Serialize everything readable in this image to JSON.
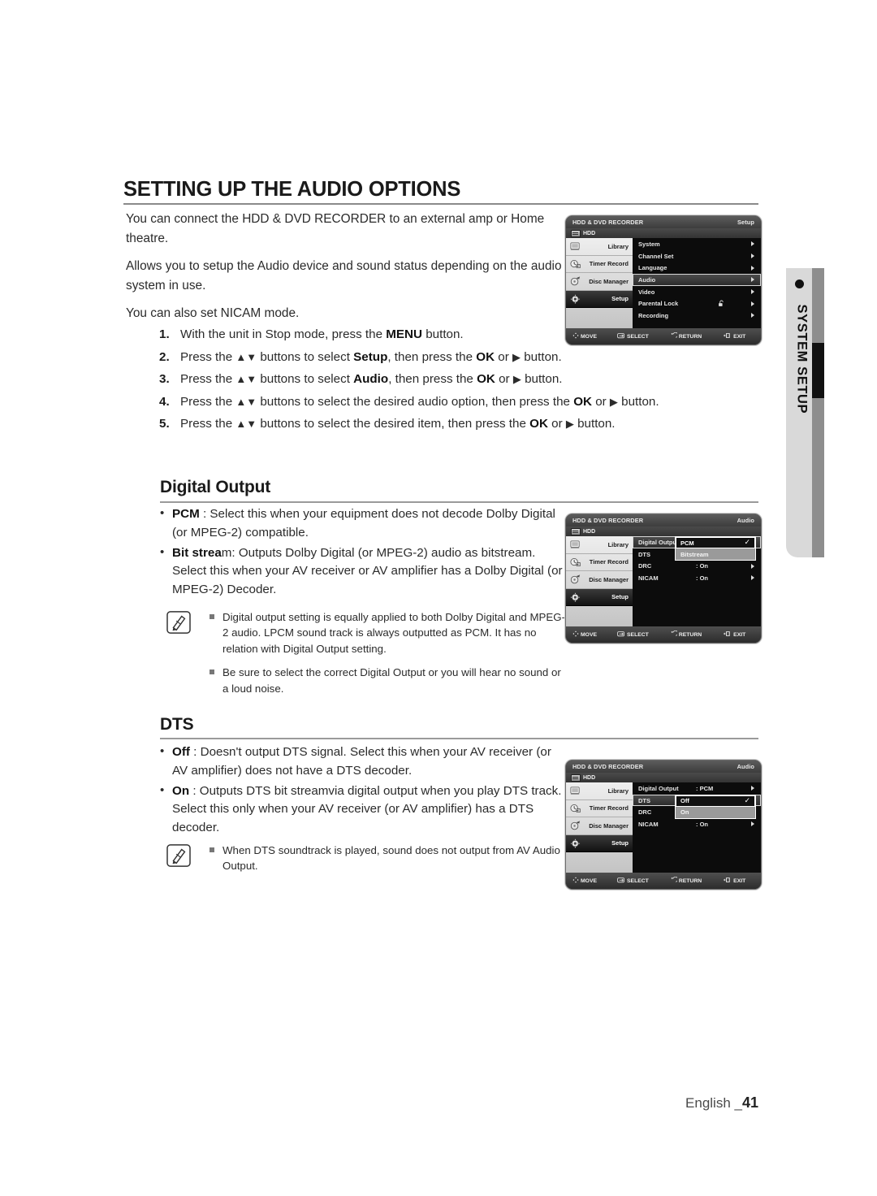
{
  "page": {
    "title": "SETTING UP THE AUDIO OPTIONS",
    "footer_label": "English _",
    "footer_number": "41",
    "side_tab_label": "SYSTEM SETUP"
  },
  "intro": {
    "p1": "You can connect the HDD & DVD RECORDER to an external amp or Home theatre.",
    "p2": "Allows you to setup the Audio device and sound status depending on the audio system in use.",
    "p3": "You can also set NICAM mode."
  },
  "steps": [
    {
      "num": "1.",
      "html": "With the unit in Stop mode, press the <b>MENU</b> button."
    },
    {
      "num": "2.",
      "html": "Press the <span class=\"arrows\">▲▼</span> buttons to select <b>Setup</b>, then press the <b>OK</b> or <span class=\"arrows\">▶</span> button."
    },
    {
      "num": "3.",
      "html": "Press the <span class=\"arrows\">▲▼</span> buttons to select <b>Audio</b>, then press the <b>OK</b> or <span class=\"arrows\">▶</span> button."
    },
    {
      "num": "4.",
      "html": "Press the <span class=\"arrows\">▲▼</span> buttons to select the desired audio option, then press the <b>OK</b> or <span class=\"arrows\">▶</span> button."
    },
    {
      "num": "5.",
      "html": "Press the <span class=\"arrows\">▲▼</span> buttons to select the desired item, then press the <b>OK</b> or <span class=\"arrows\">▶</span> button."
    }
  ],
  "digital_output": {
    "heading": "Digital Output",
    "bullets": [
      "<b>PCM</b> : Select this when your equipment does not decode Dolby Digital (or MPEG-2) compatible.",
      "<b>Bit strea</b>m: Outputs Dolby Digital (or MPEG-2) audio as bitstream. Select this when your AV receiver or AV amplifier has a Dolby Digital (or MPEG-2) Decoder."
    ],
    "notes": [
      "Digital output setting is equally applied to both Dolby Digital and MPEG-2 audio. LPCM sound track is always outputted as PCM. It has no relation with Digital Output setting.",
      "Be sure to select the correct Digital Output or you will hear no sound or a loud noise."
    ]
  },
  "dts": {
    "heading": "DTS",
    "bullets": [
      "<b>Off</b> : Doesn't output DTS signal. Select this when your AV receiver (or AV amplifier) does not have a DTS decoder.",
      "<b>On</b> : Outputs DTS bit streamvia digital output when you play DTS track. Select this only when your AV receiver (or AV amplifier) has a DTS decoder."
    ],
    "notes": [
      "When DTS soundtrack is played, sound does not output from AV Audio Output."
    ]
  },
  "osd_common": {
    "device_title": "HDD & DVD RECORDER",
    "source_label": "HDD",
    "sidebar": [
      {
        "label": "Library",
        "icon": "library-icon",
        "selected": false
      },
      {
        "label": "Timer Record",
        "icon": "timer-record-icon",
        "selected": false
      },
      {
        "label": "Disc Manager",
        "icon": "disc-manager-icon",
        "selected": false
      },
      {
        "label": "Setup",
        "icon": "setup-gear-icon",
        "selected": true
      }
    ],
    "bottom_bar": [
      {
        "icon": "move-icon",
        "label": "MOVE"
      },
      {
        "icon": "select-icon",
        "label": "SELECT"
      },
      {
        "icon": "return-icon",
        "label": "RETURN"
      },
      {
        "icon": "exit-icon",
        "label": "EXIT"
      }
    ]
  },
  "osd1": {
    "context": "Setup",
    "rows": [
      {
        "label": "System",
        "value": "",
        "highlighted": false
      },
      {
        "label": "Channel Set",
        "value": "",
        "highlighted": false
      },
      {
        "label": "Language",
        "value": "",
        "highlighted": false
      },
      {
        "label": "Audio",
        "value": "",
        "highlighted": true
      },
      {
        "label": "Video",
        "value": "",
        "highlighted": false
      },
      {
        "label": "Parental Lock",
        "value": "",
        "highlighted": false,
        "icon": "unlock-icon"
      },
      {
        "label": "Recording",
        "value": "",
        "highlighted": false
      }
    ]
  },
  "osd2": {
    "context": "Audio",
    "rows": [
      {
        "label": "Digital Output",
        "value": "",
        "highlighted": true
      },
      {
        "label": "DTS",
        "value": "",
        "highlighted": false
      },
      {
        "label": "DRC",
        "value": ": On",
        "highlighted": false
      },
      {
        "label": "NICAM",
        "value": ": On",
        "highlighted": false
      }
    ],
    "popup": {
      "options": [
        {
          "label": "PCM",
          "checked": true
        },
        {
          "label": "Bitstream",
          "checked": false
        }
      ]
    }
  },
  "osd3": {
    "context": "Audio",
    "rows": [
      {
        "label": "Digital Output",
        "value": ": PCM",
        "highlighted": false
      },
      {
        "label": "DTS",
        "value": "",
        "highlighted": true
      },
      {
        "label": "DRC",
        "value": "",
        "highlighted": false
      },
      {
        "label": "NICAM",
        "value": ": On",
        "highlighted": false
      }
    ],
    "popup": {
      "options": [
        {
          "label": "Off",
          "checked": true
        },
        {
          "label": "On",
          "checked": false
        }
      ]
    }
  }
}
